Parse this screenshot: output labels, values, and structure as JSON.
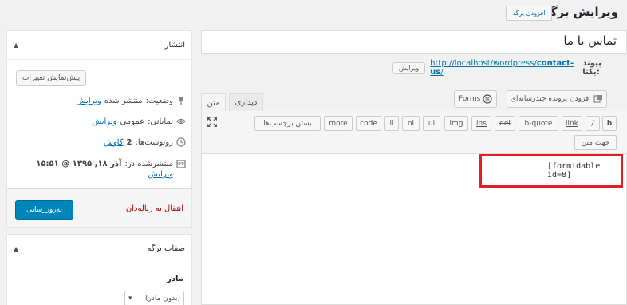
{
  "header": {
    "title": "ویرایش برگه",
    "add_new_label": "افزودن برگه"
  },
  "post_title": "تماس با ما",
  "permalink": {
    "label": "پیوند یکتا:",
    "url_prefix": "http://localhost/wordpress/",
    "url_slug": "contact-us",
    "url_suffix": "/",
    "edit_label": "ویرایش"
  },
  "media": {
    "add_media_label": "افزودن پرونده چندرسانه‌ای",
    "forms_label": "Forms"
  },
  "tabs": {
    "visual": "دیداری",
    "text": "متن"
  },
  "quicktags": [
    "b",
    "/",
    "link",
    "b-quote",
    "del",
    "ins",
    "img",
    "ul",
    "ol",
    "li",
    "code",
    "more",
    "بستن برچسب‌ها",
    "جهت متن"
  ],
  "content": "[formidable id=8]",
  "publish": {
    "title": "انتشار",
    "preview_label": "پیش‌نمایش تغییرات",
    "status_label": "وضعیت:",
    "status_value": "منتشر شده",
    "status_edit": "ویرایش",
    "visibility_label": "نمایانی:",
    "visibility_value": "عمومی",
    "visibility_edit": "ویرایش",
    "revisions_label": "رونوشت‌ها:",
    "revisions_value": "2",
    "revisions_link": "کاوش",
    "published_label": "منتشرشده در:",
    "published_value": "آذر ۱۸, ۱۳۹۵ @ ۱۵:۵۱",
    "published_edit": "ویرایش",
    "trash_label": "انتقال به زباله‌دان",
    "update_label": "به‌روزرسانی"
  },
  "attributes": {
    "title": "صفات برگه",
    "parent_label": "مادر",
    "parent_value": "(بدون مادر)"
  },
  "colors": {
    "accent": "#0085ba",
    "highlight": "#e31e24",
    "link": "#0073aa",
    "trash": "#aa0000"
  }
}
